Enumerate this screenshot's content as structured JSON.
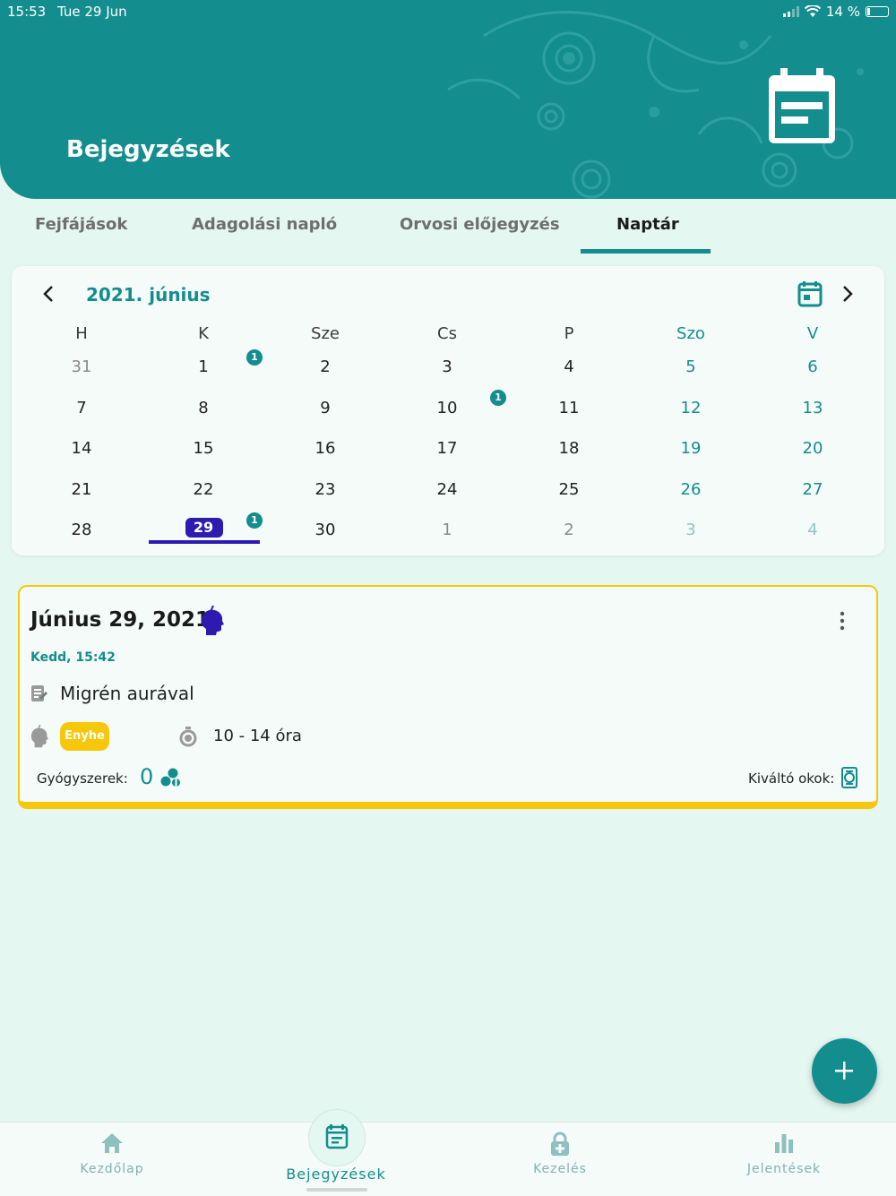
{
  "status_bar": {
    "time": "15:53",
    "date": "Tue 29 Jun",
    "battery": "14 %"
  },
  "header": {
    "title": "Bejegyzések"
  },
  "tabs": [
    {
      "label": "Fejfájások"
    },
    {
      "label": "Adagolási napló"
    },
    {
      "label": "Orvosi előjegyzés"
    },
    {
      "label": "Naptár"
    }
  ],
  "active_tab": "Naptár",
  "calendar": {
    "month_label": "2021. június",
    "weekdays": [
      "H",
      "K",
      "Sze",
      "Cs",
      "P",
      "Szo",
      "V"
    ],
    "weeks": [
      [
        "31",
        "1",
        "2",
        "3",
        "4",
        "5",
        "6"
      ],
      [
        "7",
        "8",
        "9",
        "10",
        "11",
        "12",
        "13"
      ],
      [
        "14",
        "15",
        "16",
        "17",
        "18",
        "19",
        "20"
      ],
      [
        "21",
        "22",
        "23",
        "24",
        "25",
        "26",
        "27"
      ],
      [
        "28",
        "29",
        "30",
        "1",
        "2",
        "3",
        "4"
      ]
    ],
    "badges": [
      "1",
      "1",
      "1"
    ],
    "selected_day": "29"
  },
  "entry": {
    "date": "Június 29, 2021",
    "time": "Kedd, 15:42",
    "diagnosis": "Migrén aurával",
    "severity": "Enyhe",
    "duration": "10 - 14 óra",
    "medications_label": "Gyógyszerek:",
    "medications_count": "0",
    "triggers_label": "Kiváltó okok:"
  },
  "bottom_nav": [
    {
      "label": "Kezdőlap"
    },
    {
      "label": "Bejegyzések"
    },
    {
      "label": "Kezelés"
    },
    {
      "label": "Jelentések"
    }
  ],
  "active_nav": "Bejegyzések",
  "colors": {
    "primary": "#138d8e",
    "accent": "#2d1ab0",
    "severity_mild": "#f6c70a",
    "background": "#e4f7f1"
  },
  "icons": [
    "calendar-icon",
    "chevron-left-icon",
    "chevron-right-icon",
    "migraine-head-icon",
    "more-vert-icon",
    "note-icon",
    "timer-icon",
    "pills-icon",
    "trigger-icon",
    "plus-icon",
    "home-icon",
    "lock-icon",
    "chart-icon"
  ]
}
